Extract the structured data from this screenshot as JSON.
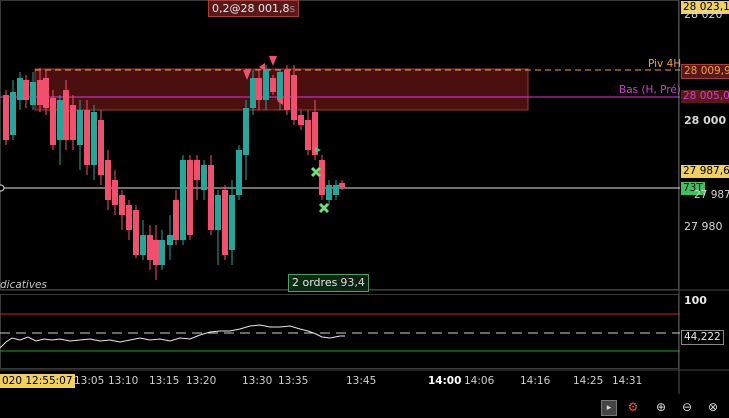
{
  "price_axis": {
    "labels": [
      {
        "text": "28 020",
        "price": 28020
      },
      {
        "text": "28 000",
        "price": 28000
      },
      {
        "text": "27 980",
        "price": 27980
      }
    ],
    "current_high_tag": "28 023,1",
    "pivot_tag": "28 009,9",
    "low_tag": "28 005,0",
    "last_price_tag": "27 987,6",
    "cursor_tag": "27 987,6",
    "countdown_badge": "73T"
  },
  "overlay": {
    "top_label": "0,2@28 001,8",
    "top_label_suffix": "s",
    "pivot_label": "Piv 4H",
    "low_label": "Bas (H, Pré)",
    "indicatives_label": "dicatives",
    "orders_label": "2 ordres",
    "orders_value": "93,4"
  },
  "indicator": {
    "axis_label": "100",
    "value_tag": "44,222",
    "value": 44.222
  },
  "time_axis": {
    "cursor_time": "020 12:55:07",
    "labels": [
      {
        "text": "13:05",
        "bold": false
      },
      {
        "text": "13:10",
        "bold": false
      },
      {
        "text": "13:15",
        "bold": false
      },
      {
        "text": "13:20",
        "bold": false
      },
      {
        "text": "13:30",
        "bold": false
      },
      {
        "text": "13:35",
        "bold": false
      },
      {
        "text": "13:45",
        "bold": false
      },
      {
        "text": "14:00",
        "bold": true
      },
      {
        "text": "14:06",
        "bold": false
      },
      {
        "text": "14:16",
        "bold": false
      },
      {
        "text": "14:25",
        "bold": false
      },
      {
        "text": "14:31",
        "bold": false
      }
    ]
  },
  "colors": {
    "bull": "#26a69a",
    "bear": "#f0506e",
    "pivot": "#f0a040",
    "low": "#d040d0",
    "zone_fill": "#5a1212",
    "zone_stroke": "#c04040",
    "background": "#000000"
  },
  "toolbar": {
    "icons": [
      "scroll-left-icon",
      "settings-icon",
      "zoom-in-icon",
      "zoom-out-icon"
    ]
  }
}
